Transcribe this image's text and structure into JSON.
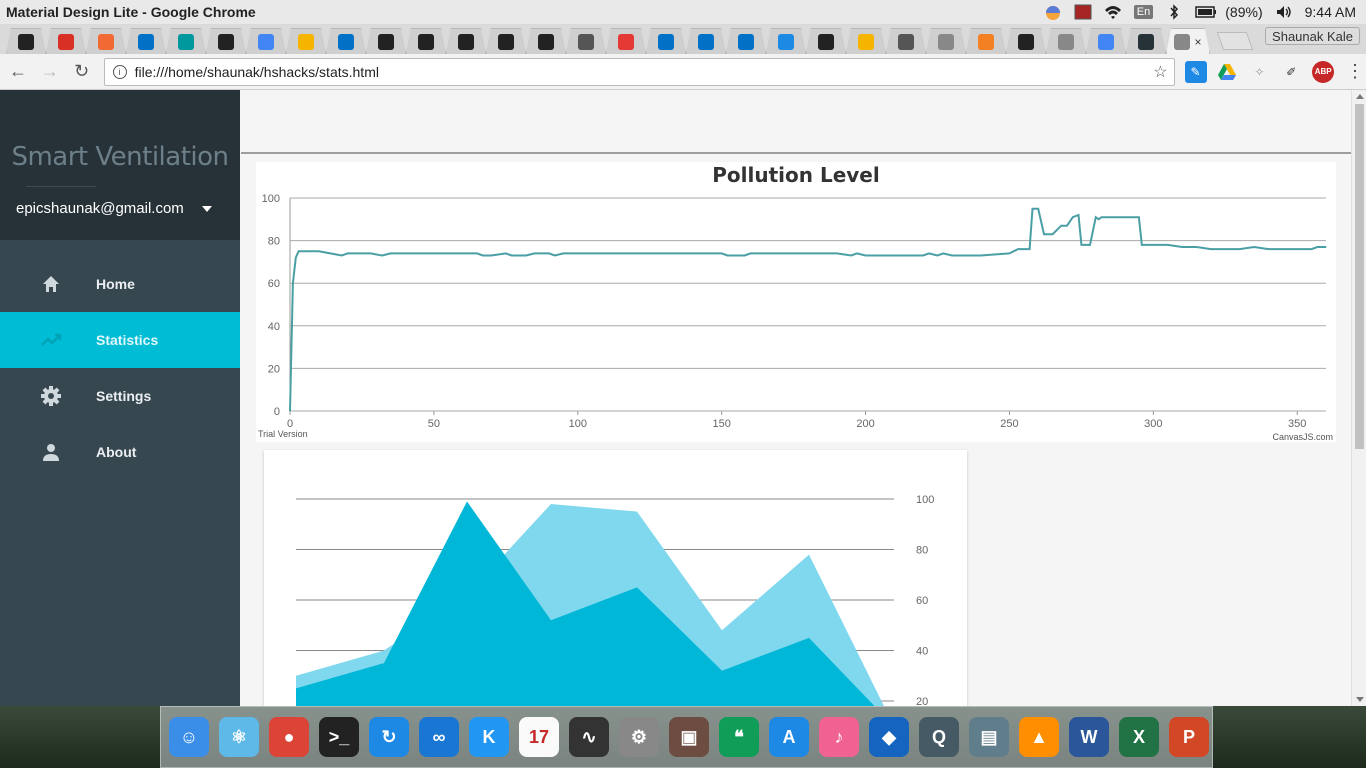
{
  "window": {
    "title": "Material Design Lite - Google Chrome",
    "battery": "(89%)",
    "time": "9:44 AM",
    "input_lang": "En"
  },
  "tabs": {
    "profile_name": "Shaunak Kale",
    "items": [
      {
        "icon": "github-icon",
        "color": "#222"
      },
      {
        "icon": "gmail-icon",
        "color": "#d93025"
      },
      {
        "icon": "askfm-icon",
        "color": "#f26a33"
      },
      {
        "icon": "intel-icon",
        "color": "#0071c5"
      },
      {
        "icon": "arduino-icon",
        "color": "#00979d"
      },
      {
        "icon": "star-icon",
        "color": "#222"
      },
      {
        "icon": "google-icon",
        "color": "#4285f4"
      },
      {
        "icon": "bulb-icon",
        "color": "#f4b400"
      },
      {
        "icon": "intel-icon",
        "color": "#0071c5"
      },
      {
        "icon": "github-icon",
        "color": "#222"
      },
      {
        "icon": "element-icon",
        "color": "#222"
      },
      {
        "icon": "amazon-icon",
        "color": "#222"
      },
      {
        "icon": "github-icon",
        "color": "#222"
      },
      {
        "icon": "github-icon",
        "color": "#222"
      },
      {
        "icon": "owl-icon",
        "color": "#555"
      },
      {
        "icon": "pin-icon",
        "color": "#e53935"
      },
      {
        "icon": "intel-icon",
        "color": "#0071c5"
      },
      {
        "icon": "intel-icon",
        "color": "#0071c5"
      },
      {
        "icon": "intel-icon",
        "color": "#0071c5"
      },
      {
        "icon": "hackster-icon",
        "color": "#1e88e5"
      },
      {
        "icon": "github-icon",
        "color": "#222"
      },
      {
        "icon": "robot-icon",
        "color": "#f4b400"
      },
      {
        "icon": "chart-icon",
        "color": "#555"
      },
      {
        "icon": "file-icon",
        "color": "#888"
      },
      {
        "icon": "stackoverflow-icon",
        "color": "#f48024"
      },
      {
        "icon": "github-icon",
        "color": "#222"
      },
      {
        "icon": "file-icon",
        "color": "#888"
      },
      {
        "icon": "google-icon",
        "color": "#4285f4"
      },
      {
        "icon": "d-icon",
        "color": "#263238"
      },
      {
        "icon": "page-icon",
        "color": "#888",
        "active": true
      }
    ]
  },
  "toolbar": {
    "url": "file:///home/shaunak/hshacks/stats.html"
  },
  "drawer": {
    "brand": "Smart Ventilation",
    "account": "epicshaunak@gmail.com",
    "items": [
      {
        "label": "Home",
        "icon": "home-icon"
      },
      {
        "label": "Statistics",
        "icon": "trending-up-icon",
        "active": true
      },
      {
        "label": "Settings",
        "icon": "settings-icon"
      },
      {
        "label": "About",
        "icon": "person-icon"
      }
    ]
  },
  "chart_data": [
    {
      "type": "line",
      "title": "Pollution Level",
      "footer_left": "Trial Version",
      "footer_right": "CanvasJS.com",
      "xlim": [
        0,
        360
      ],
      "ylim": [
        0,
        100
      ],
      "xticks": [
        0,
        50,
        100,
        150,
        200,
        250,
        300,
        350
      ],
      "yticks": [
        0,
        20,
        40,
        60,
        80,
        100
      ],
      "line_color": "#4a9fa5",
      "series": [
        {
          "x": [
            0,
            1,
            2,
            3,
            10,
            18,
            20,
            28,
            32,
            35,
            65,
            67,
            70,
            75,
            77,
            82,
            85,
            90,
            92,
            95,
            100,
            150,
            152,
            158,
            160,
            190,
            195,
            197,
            200,
            220,
            222,
            225,
            227,
            230,
            235,
            240,
            250,
            253,
            255,
            257,
            258,
            260,
            262,
            263,
            265,
            268,
            270,
            272,
            274,
            275,
            277,
            278,
            280,
            281,
            282,
            285,
            290,
            295,
            296,
            297,
            300,
            305,
            310,
            315,
            320,
            330,
            335,
            340,
            350,
            355,
            357,
            360
          ],
          "y": [
            0,
            60,
            72,
            75,
            75,
            73,
            74,
            74,
            73,
            74,
            74,
            73,
            73,
            74,
            73,
            73,
            74,
            74,
            73,
            74,
            74,
            74,
            73,
            73,
            74,
            74,
            73,
            74,
            73,
            73,
            74,
            73,
            74,
            73,
            73,
            73,
            74,
            76,
            76,
            76,
            95,
            95,
            83,
            83,
            83,
            87,
            87,
            91,
            92,
            78,
            78,
            78,
            91,
            90,
            91,
            91,
            91,
            91,
            78,
            78,
            78,
            78,
            77,
            77,
            76,
            76,
            77,
            76,
            76,
            76,
            77,
            77
          ]
        }
      ]
    },
    {
      "type": "area",
      "yticks": [
        100,
        80,
        60,
        40,
        20
      ],
      "ylim": [
        0,
        110
      ],
      "x": [
        0,
        1,
        2,
        3,
        4,
        5,
        6,
        7
      ],
      "series": [
        {
          "color": "#80d8ee",
          "values": [
            30,
            40,
            62,
            98,
            95,
            48,
            78,
            10
          ]
        },
        {
          "color": "#00b7d8",
          "values": [
            25,
            35,
            99,
            52,
            65,
            32,
            45,
            10
          ]
        }
      ]
    }
  ],
  "dock": {
    "apps": [
      {
        "icon": "finder-icon",
        "color": "#3b8ee8",
        "glyph": "☺"
      },
      {
        "icon": "atom-icon",
        "color": "#5fb9e8",
        "glyph": "⚛"
      },
      {
        "icon": "chrome-icon",
        "color": "#db4437",
        "glyph": "●"
      },
      {
        "icon": "terminal-icon",
        "color": "#222",
        "glyph": ">_"
      },
      {
        "icon": "sync-icon",
        "color": "#1e88e5",
        "glyph": "↻"
      },
      {
        "icon": "arduino-icon",
        "color": "#1976d2",
        "glyph": "∞"
      },
      {
        "icon": "kde-connect-icon",
        "color": "#2196f3",
        "glyph": "K"
      },
      {
        "icon": "calendar-icon",
        "color": "#fafafa",
        "glyph": "17"
      },
      {
        "icon": "activity-monitor-icon",
        "color": "#333",
        "glyph": "∿"
      },
      {
        "icon": "system-prefs-icon",
        "color": "#888",
        "glyph": "⚙"
      },
      {
        "icon": "preview-icon",
        "color": "#6d4c41",
        "glyph": "▣"
      },
      {
        "icon": "hangouts-icon",
        "color": "#0f9d58",
        "glyph": "❝"
      },
      {
        "icon": "app-store-icon",
        "color": "#1e88e5",
        "glyph": "A"
      },
      {
        "icon": "itunes-icon",
        "color": "#f06292",
        "glyph": "♪"
      },
      {
        "icon": "kodi-icon",
        "color": "#1565c0",
        "glyph": "◆"
      },
      {
        "icon": "quicktime-icon",
        "color": "#455a64",
        "glyph": "Q"
      },
      {
        "icon": "video-sync-icon",
        "color": "#607d8b",
        "glyph": "▤"
      },
      {
        "icon": "vlc-icon",
        "color": "#ff8f00",
        "glyph": "▲"
      },
      {
        "icon": "word-icon",
        "color": "#2b579a",
        "glyph": "W"
      },
      {
        "icon": "excel-icon",
        "color": "#217346",
        "glyph": "X"
      },
      {
        "icon": "powerpoint-icon",
        "color": "#d24726",
        "glyph": "P"
      }
    ]
  }
}
